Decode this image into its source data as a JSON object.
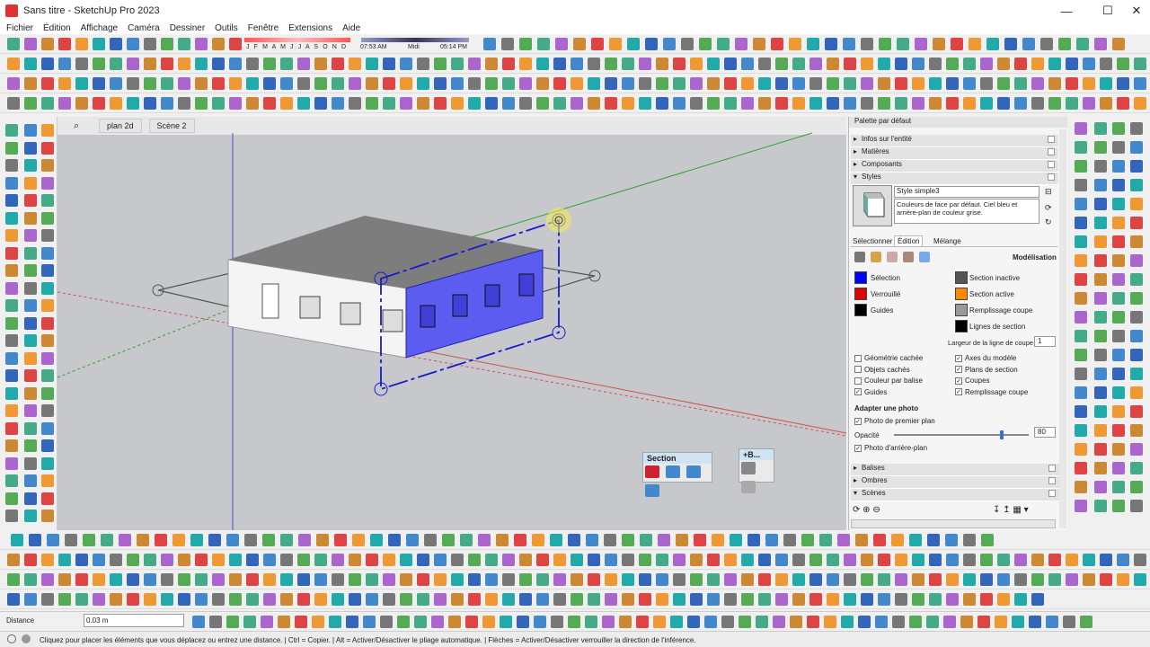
{
  "window": {
    "title": "Sans titre - SketchUp Pro 2023"
  },
  "menu": [
    "Fichier",
    "Édition",
    "Affichage",
    "Caméra",
    "Dessiner",
    "Outils",
    "Fenêtre",
    "Extensions",
    "Aide"
  ],
  "shadow": {
    "months": "J F M A M J J A S O N D",
    "time_start": "07:53 AM",
    "time_mid": "Midi",
    "time_end": "05:14 PM"
  },
  "scene_tabs": [
    "plan 2d",
    "Scène 2"
  ],
  "section_palette": {
    "title": "Section"
  },
  "small_palette": {
    "title": "+B..."
  },
  "tray": {
    "title": "Palette par défaut",
    "sections_top": [
      "Infos sur l'entité",
      "Matières",
      "Composants",
      "Styles"
    ],
    "style_name": "Style simple3",
    "style_desc": "Couleurs de face par défaut. Ciel bleu et arrière-plan de couleur grise.",
    "tabs": [
      "Sélectionner",
      "Édition",
      "Mélange"
    ],
    "active_tab": "Édition",
    "mode_label": "Modélisation",
    "swatches_left": [
      {
        "label": "Sélection",
        "color": "#0000ff"
      },
      {
        "label": "Verrouillé",
        "color": "#e00000"
      },
      {
        "label": "Guides",
        "color": "#000000"
      }
    ],
    "swatches_right": [
      {
        "label": "Section inactive",
        "color": "#555555"
      },
      {
        "label": "Section active",
        "color": "#ff8800"
      },
      {
        "label": "Remplissage coupe",
        "color": "#999999"
      },
      {
        "label": "Lignes de section",
        "color": "#000000"
      }
    ],
    "line_width_label": "Largeur de la ligne de coupe",
    "line_width_value": "1",
    "checks_left": [
      {
        "label": "Géométrie cachée",
        "checked": false
      },
      {
        "label": "Objets cachés",
        "checked": false
      },
      {
        "label": "Couleur par balise",
        "checked": false
      },
      {
        "label": "Guides",
        "checked": true
      }
    ],
    "checks_right": [
      {
        "label": "Axes du modèle",
        "checked": true
      },
      {
        "label": "Plans de section",
        "checked": true
      },
      {
        "label": "Coupes",
        "checked": true
      },
      {
        "label": "Remplissage coupe",
        "checked": true
      }
    ],
    "photo_title": "Adapter une photo",
    "photo_front": "Photo de premier plan",
    "opacity_label": "Opacité",
    "opacity_value": "80",
    "opacity_level": 0.8,
    "photo_back": "Photo d'arrière-plan",
    "sections_bottom": [
      "Balises",
      "Ombres",
      "Scènes"
    ]
  },
  "measurement": {
    "label": "Distance",
    "value": "0.03 m"
  },
  "status": "Cliquez pour placer les éléments que vous déplacez ou entrez une distance. | Ctrl = Copier. | Alt = Activer/Désactiver le pliage automatique. | Flèches = Activer/Désactiver verrouiller la direction de l'inférence.",
  "colors": {
    "viewport_bg": "#c6c8cb",
    "accent": "#0000ff"
  }
}
